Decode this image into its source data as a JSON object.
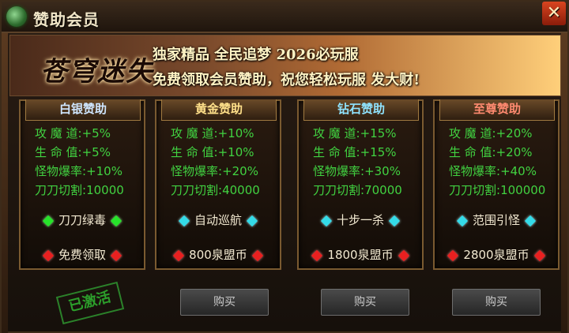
{
  "window": {
    "title": "赞助会员",
    "close_label": "✕",
    "title_icon": "dragon-emblem-icon"
  },
  "banner": {
    "logo": "苍穹迷失",
    "line1": "独家精品 全民追梦 2026必玩服",
    "line2": "免费领取会员赞助，祝您轻松玩服 发大财!"
  },
  "labels": {
    "attack": "攻 魔 道:",
    "hp": "生 命 值:",
    "drop": "怪物爆率:",
    "cut": "刀刀切割:"
  },
  "cards": [
    {
      "title": "白银赞助",
      "title_color": "#cfe6ff",
      "attack": "+5%",
      "hp": "+5%",
      "drop": "+10%",
      "cut": "10000",
      "feature": "刀刀绿毒",
      "feature_gem": "green",
      "price": "免费领取"
    },
    {
      "title": "黄金赞助",
      "title_color": "#ffe08a",
      "attack": "+10%",
      "hp": "+10%",
      "drop": "+20%",
      "cut": "40000",
      "feature": "自动巡航",
      "feature_gem": "cyan",
      "price": "800泉盟币"
    },
    {
      "title": "钻石赞助",
      "title_color": "#8fe3ff",
      "attack": "+15%",
      "hp": "+15%",
      "drop": "+30%",
      "cut": "70000",
      "feature": "十步一杀",
      "feature_gem": "cyan",
      "price": "1800泉盟币"
    },
    {
      "title": "至尊赞助",
      "title_color": "#ff8a70",
      "attack": "+20%",
      "hp": "+20%",
      "drop": "+40%",
      "cut": "100000",
      "feature": "范围引怪",
      "feature_gem": "cyan",
      "price": "2800泉盟币"
    }
  ],
  "footer": {
    "stamp": "已激活",
    "buy_label": "购买"
  },
  "colors": {
    "stat_green": "#41d241",
    "gem_green": "#27e32a",
    "gem_cyan": "#34dbe8",
    "gem_red": "#e82020"
  }
}
